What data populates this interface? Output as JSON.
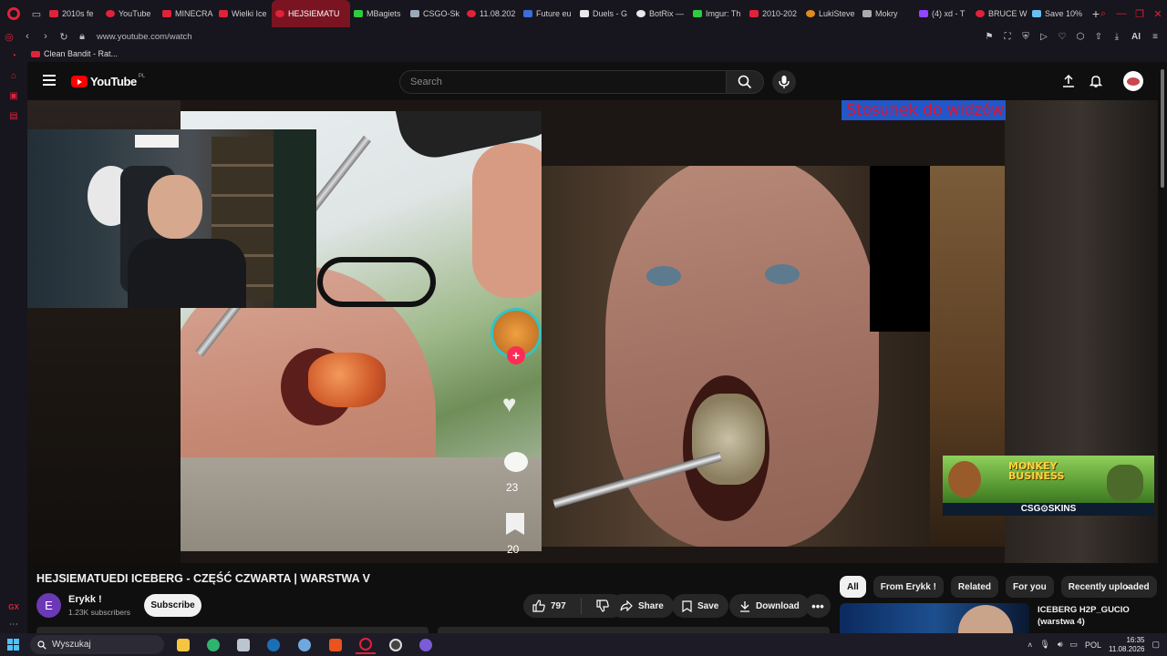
{
  "browser": {
    "tabs": [
      {
        "label": "2010s fe",
        "color": "#e0223a"
      },
      {
        "label": "YouTube",
        "color": "#e0223a"
      },
      {
        "label": "MINECRA",
        "color": "#e0223a"
      },
      {
        "label": "Wielki Ice",
        "color": "#e0223a"
      },
      {
        "label": "HEJSIEMATU",
        "color": "#e0223a",
        "active": true
      },
      {
        "label": "MBagiets",
        "color": "#2ecc40"
      },
      {
        "label": "CSGO-Sk",
        "color": "#9ab"
      },
      {
        "label": "11.08.202",
        "color": "#e0223a"
      },
      {
        "label": "Future eu",
        "color": "#3b6ed8"
      },
      {
        "label": "Duels - G",
        "color": "#e9e9e9"
      },
      {
        "label": "BotRix —",
        "color": "#e9e9e9"
      },
      {
        "label": "Imgur: Th",
        "color": "#2ecc40"
      },
      {
        "label": "2010-202",
        "color": "#e0223a"
      },
      {
        "label": "LukiSteve",
        "color": "#e08a22"
      },
      {
        "label": "Mokry",
        "color": "#aaa"
      },
      {
        "label": "(4) xd - T",
        "color": "#9146ff"
      },
      {
        "label": "BRUCE W",
        "color": "#e0223a"
      },
      {
        "label": "Save 10%",
        "color": "#66c0f4"
      }
    ],
    "url": "www.youtube.com/watch",
    "bookmark": "Clean Bandit - Rat...",
    "ai_label": "AI",
    "sidebar_gx": "GX",
    "accent": "#e0223a"
  },
  "youtube": {
    "logo_text": "YouTube",
    "region": "PL",
    "search_placeholder": "Search",
    "video": {
      "overlay_text": "Stosunek do widzów",
      "tiktok_comments": "23",
      "tiktok_saves": "20",
      "ad_title_line1": "MONKEY",
      "ad_title_line2": "BUSINESS",
      "ad_brand": "CSG⊙SKINS"
    },
    "title": "HEJSIEMATUEDI ICEBERG - CZĘŚĆ CZWARTA | WARSTWA V",
    "channel": {
      "initial": "E",
      "name": "Erykk !",
      "subscribers": "1.23K subscribers",
      "subscribe_label": "Subscribe"
    },
    "actions": {
      "likes": "797",
      "share": "Share",
      "save": "Save",
      "download": "Download"
    },
    "chips": [
      "All",
      "From Erykk !",
      "Related",
      "For you",
      "Recently uploaded"
    ],
    "recommended": {
      "title": "ICEBERG H2P_GUCIO (warstwa 4)"
    }
  },
  "taskbar": {
    "search_label": "Wyszukaj",
    "lang": "POL",
    "time": "16:35",
    "date": "11.08.2026"
  }
}
